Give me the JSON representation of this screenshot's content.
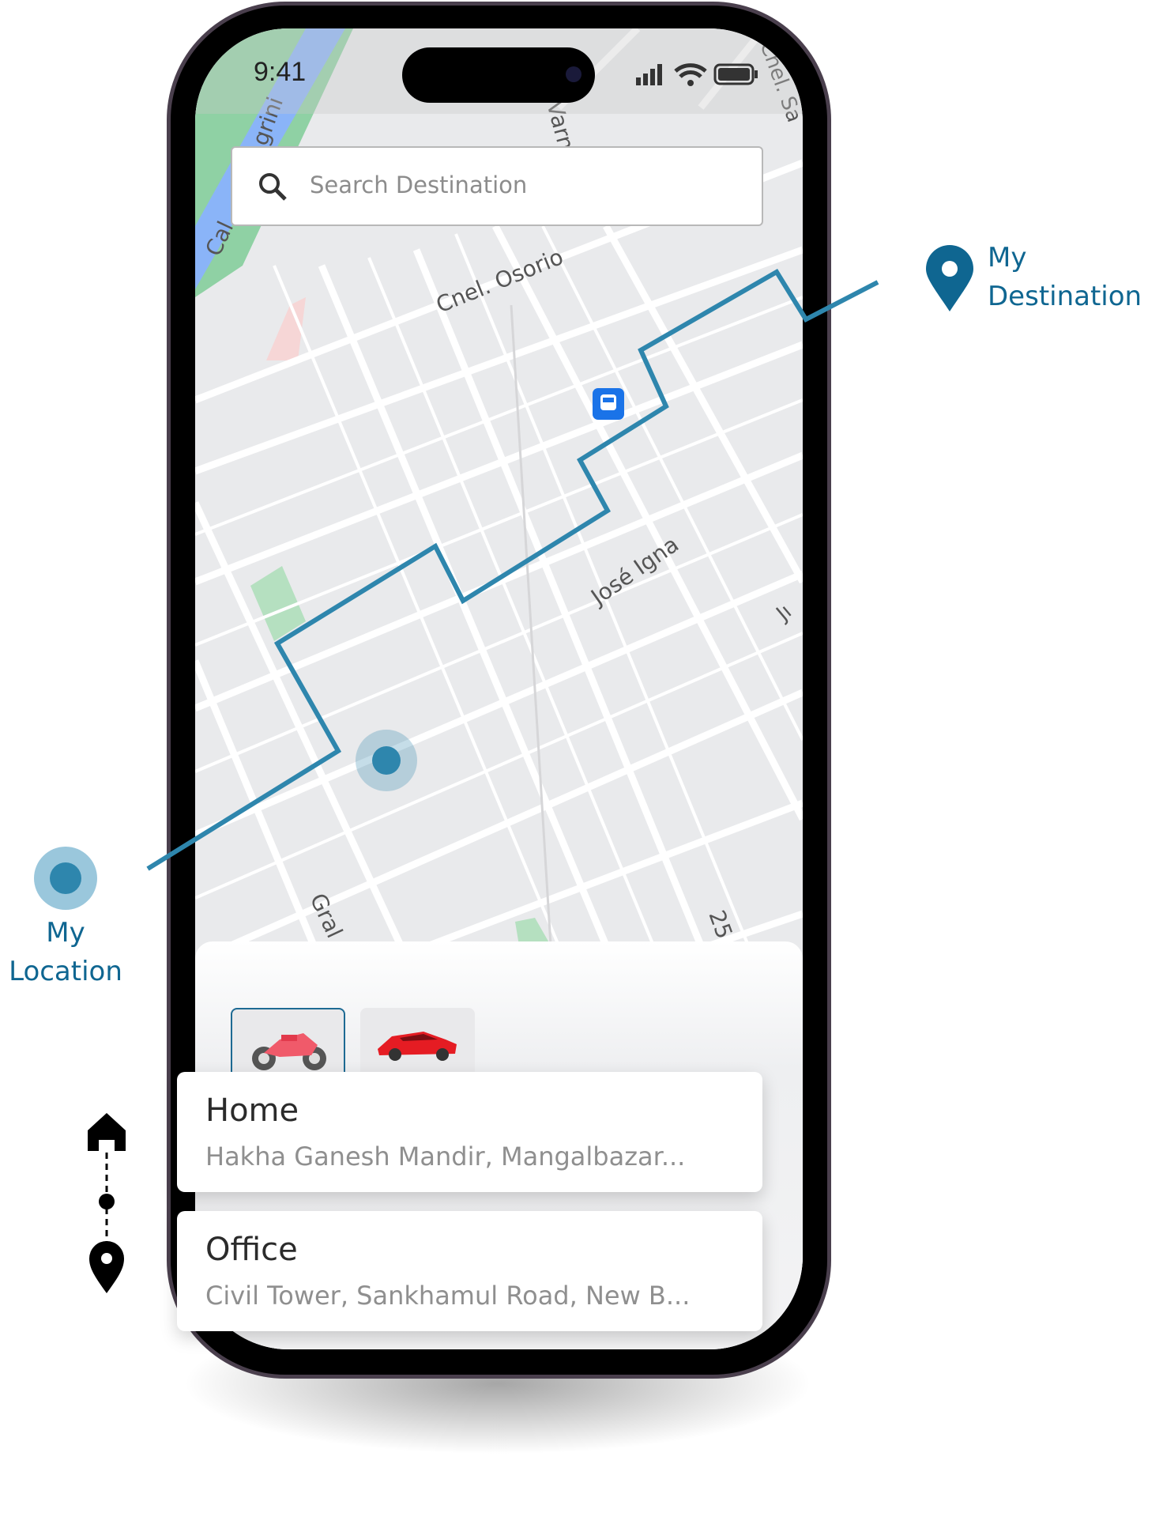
{
  "status_bar": {
    "time": "9:41"
  },
  "search": {
    "placeholder": "Search Destination"
  },
  "map": {
    "street_labels": [
      "Cnel. Osorio",
      "José Igna",
      "grini",
      "Cal",
      "Gral",
      "25",
      "Varn",
      "Cnel. Sa",
      "Jı"
    ],
    "route_color": "#2e86ad",
    "transit_icon": "bus-stop-icon"
  },
  "vehicles": [
    {
      "icon": "motorcycle-icon",
      "selected": true
    },
    {
      "icon": "car-icon",
      "selected": false
    }
  ],
  "places": [
    {
      "title": "Home",
      "address": "Hakha Ganesh Mandir, Mangalbazar..."
    },
    {
      "title": "Office",
      "address": "Civil Tower, Sankhamul Road, New B..."
    }
  ],
  "annotations": {
    "my_location": {
      "line1": "My",
      "line2": "Location"
    },
    "my_destination": {
      "line1": "My",
      "line2": "Destination"
    },
    "accent": "#0f6691"
  }
}
